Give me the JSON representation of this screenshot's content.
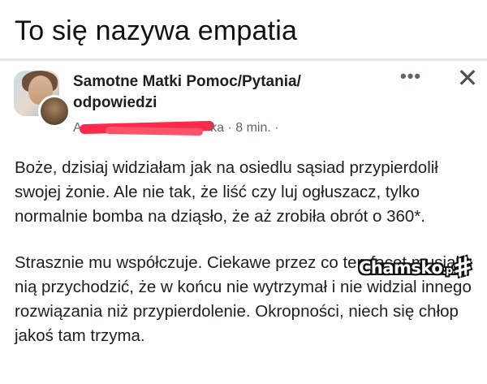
{
  "meme": {
    "title": "To się nazywa empatia"
  },
  "post": {
    "group_name": "Samotne Matki Pomoc/Pytania/ odpowiedzi",
    "author_visible": "A",
    "author_visible_end": "ka",
    "timestamp": "· 8 min. ·",
    "more_icon": "more-horizontal-icon",
    "close_icon": "close-icon",
    "body": [
      "Boże, dzisiaj widziałam jak na osiedlu sąsiad przypierdolił swojej żonie. Ale nie tak, że liść czy luj ogłuszacz, tylko normalnie bomba na dziąsło, że aż zrobiła obrót o 360*.",
      "Strasznie mu współczuje. Ciekawe przez co ten facet musiał z nią przychodzić, że w końcu nie wytrzymał i nie widzial innego rozwiązania niż przypierdolenie. Okropności, niech się chłop jakoś tam trzyma."
    ]
  },
  "watermark": {
    "text": "Chamsko",
    "suffix": ".pl",
    "hash": "#"
  },
  "colors": {
    "text": "#1c1e21",
    "secondary_text": "#606770",
    "redaction": "#ff2a4a"
  }
}
